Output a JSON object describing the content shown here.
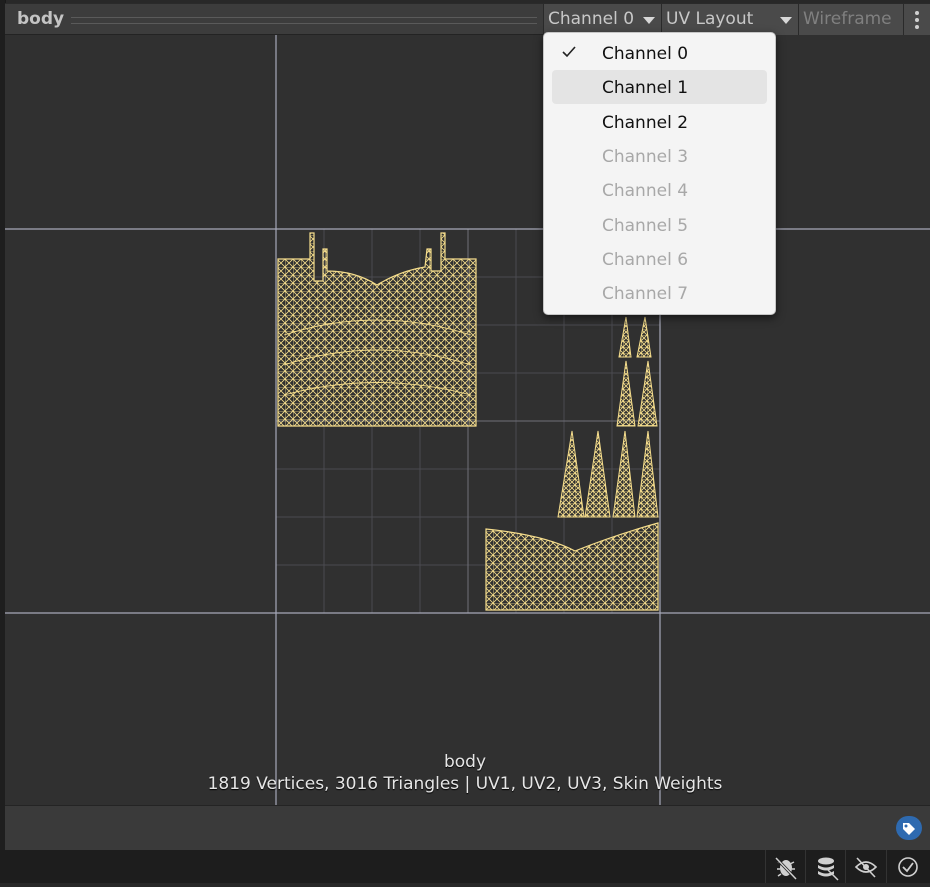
{
  "header": {
    "title": "body",
    "channel_select": "Channel 0",
    "view_mode_select": "UV Layout",
    "wireframe_label": "Wireframe"
  },
  "channel_menu": {
    "items": [
      {
        "label": "Channel 0",
        "checked": true,
        "enabled": true
      },
      {
        "label": "Channel 1",
        "checked": false,
        "enabled": true,
        "hovered": true
      },
      {
        "label": "Channel 2",
        "checked": false,
        "enabled": true
      },
      {
        "label": "Channel 3",
        "checked": false,
        "enabled": false
      },
      {
        "label": "Channel 4",
        "checked": false,
        "enabled": false
      },
      {
        "label": "Channel 5",
        "checked": false,
        "enabled": false
      },
      {
        "label": "Channel 6",
        "checked": false,
        "enabled": false
      },
      {
        "label": "Channel 7",
        "checked": false,
        "enabled": false
      }
    ]
  },
  "preview": {
    "mesh_name": "body",
    "stats": "1819 Vertices, 3016 Triangles | UV1, UV2, UV3, Skin Weights",
    "wire_color": "#f5dd8c"
  },
  "status_icons": [
    "bug-slash-icon",
    "layers-slash-icon",
    "eye-slash-icon",
    "check-circle-icon"
  ],
  "colors": {
    "accent_blue": "#2e6ab0",
    "grid_major": "#a6a8b8"
  }
}
